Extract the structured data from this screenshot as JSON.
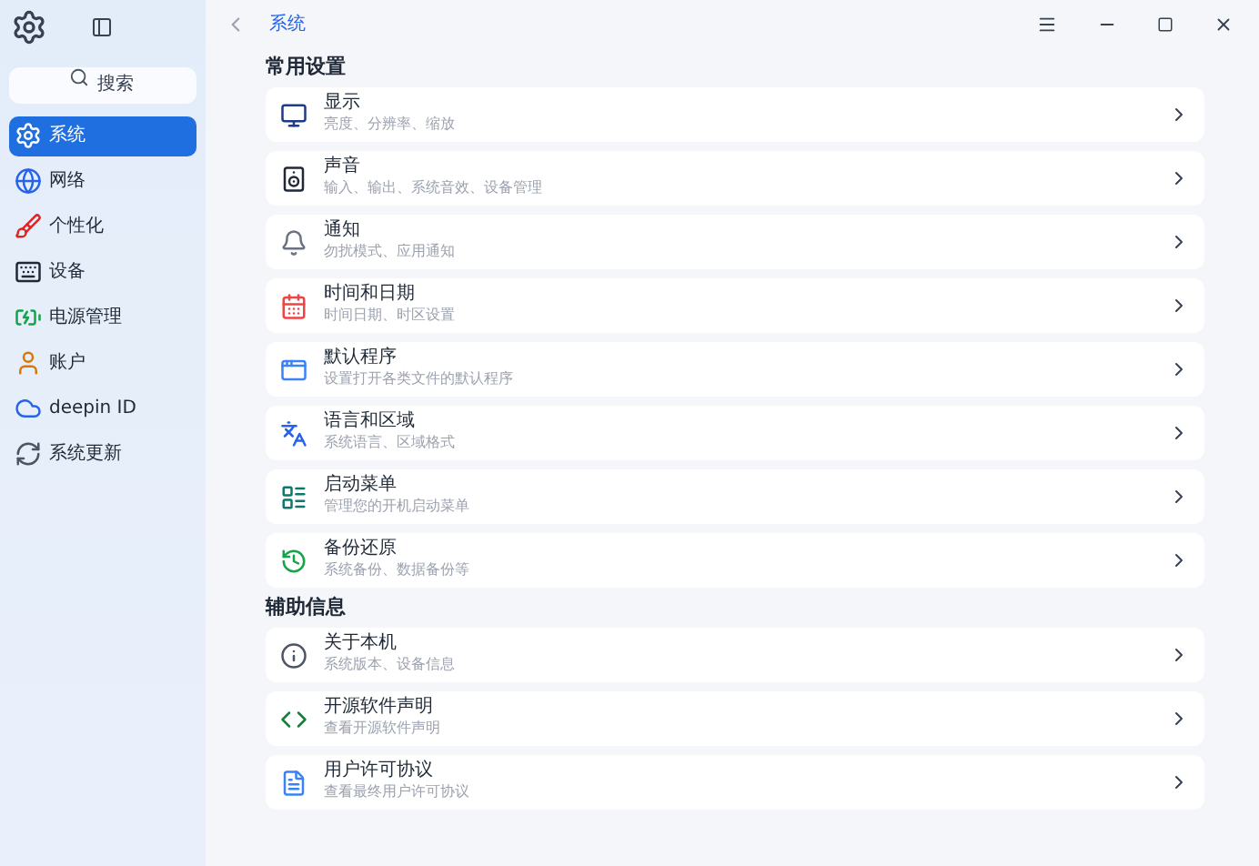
{
  "sidebar": {
    "search": {
      "placeholder": "搜索"
    },
    "items": [
      {
        "label": "系统",
        "selected": true,
        "kind": "system"
      },
      {
        "label": "网络",
        "selected": false,
        "kind": "network"
      },
      {
        "label": "个性化",
        "selected": false,
        "kind": "personal"
      },
      {
        "label": "设备",
        "selected": false,
        "kind": "device"
      },
      {
        "label": "电源管理",
        "selected": false,
        "kind": "power"
      },
      {
        "label": "账户",
        "selected": false,
        "kind": "account"
      },
      {
        "label": "deepin ID",
        "selected": false,
        "kind": "cloud"
      },
      {
        "label": "系统更新",
        "selected": false,
        "kind": "update"
      }
    ]
  },
  "header": {
    "breadcrumb": "系统"
  },
  "sections": [
    {
      "title": "常用设置",
      "items": [
        {
          "title": "显示",
          "subtitle": "亮度、分辨率、缩放",
          "kind": "display"
        },
        {
          "title": "声音",
          "subtitle": "输入、输出、系统音效、设备管理",
          "kind": "speaker"
        },
        {
          "title": "通知",
          "subtitle": "勿扰模式、应用通知",
          "kind": "bell"
        },
        {
          "title": "时间和日期",
          "subtitle": "时间日期、时区设置",
          "kind": "calendar"
        },
        {
          "title": "默认程序",
          "subtitle": "设置打开各类文件的默认程序",
          "kind": "apps"
        },
        {
          "title": "语言和区域",
          "subtitle": "系统语言、区域格式",
          "kind": "language"
        },
        {
          "title": "启动菜单",
          "subtitle": "管理您的开机启动菜单",
          "kind": "boot"
        },
        {
          "title": "备份还原",
          "subtitle": "系统备份、数据备份等",
          "kind": "backup"
        }
      ]
    },
    {
      "title": "辅助信息",
      "items": [
        {
          "title": "关于本机",
          "subtitle": "系统版本、设备信息",
          "kind": "info"
        },
        {
          "title": "开源软件声明",
          "subtitle": "查看开源软件声明",
          "kind": "opensource"
        },
        {
          "title": "用户许可协议",
          "subtitle": "查看最终用户许可协议",
          "kind": "license"
        }
      ]
    }
  ]
}
